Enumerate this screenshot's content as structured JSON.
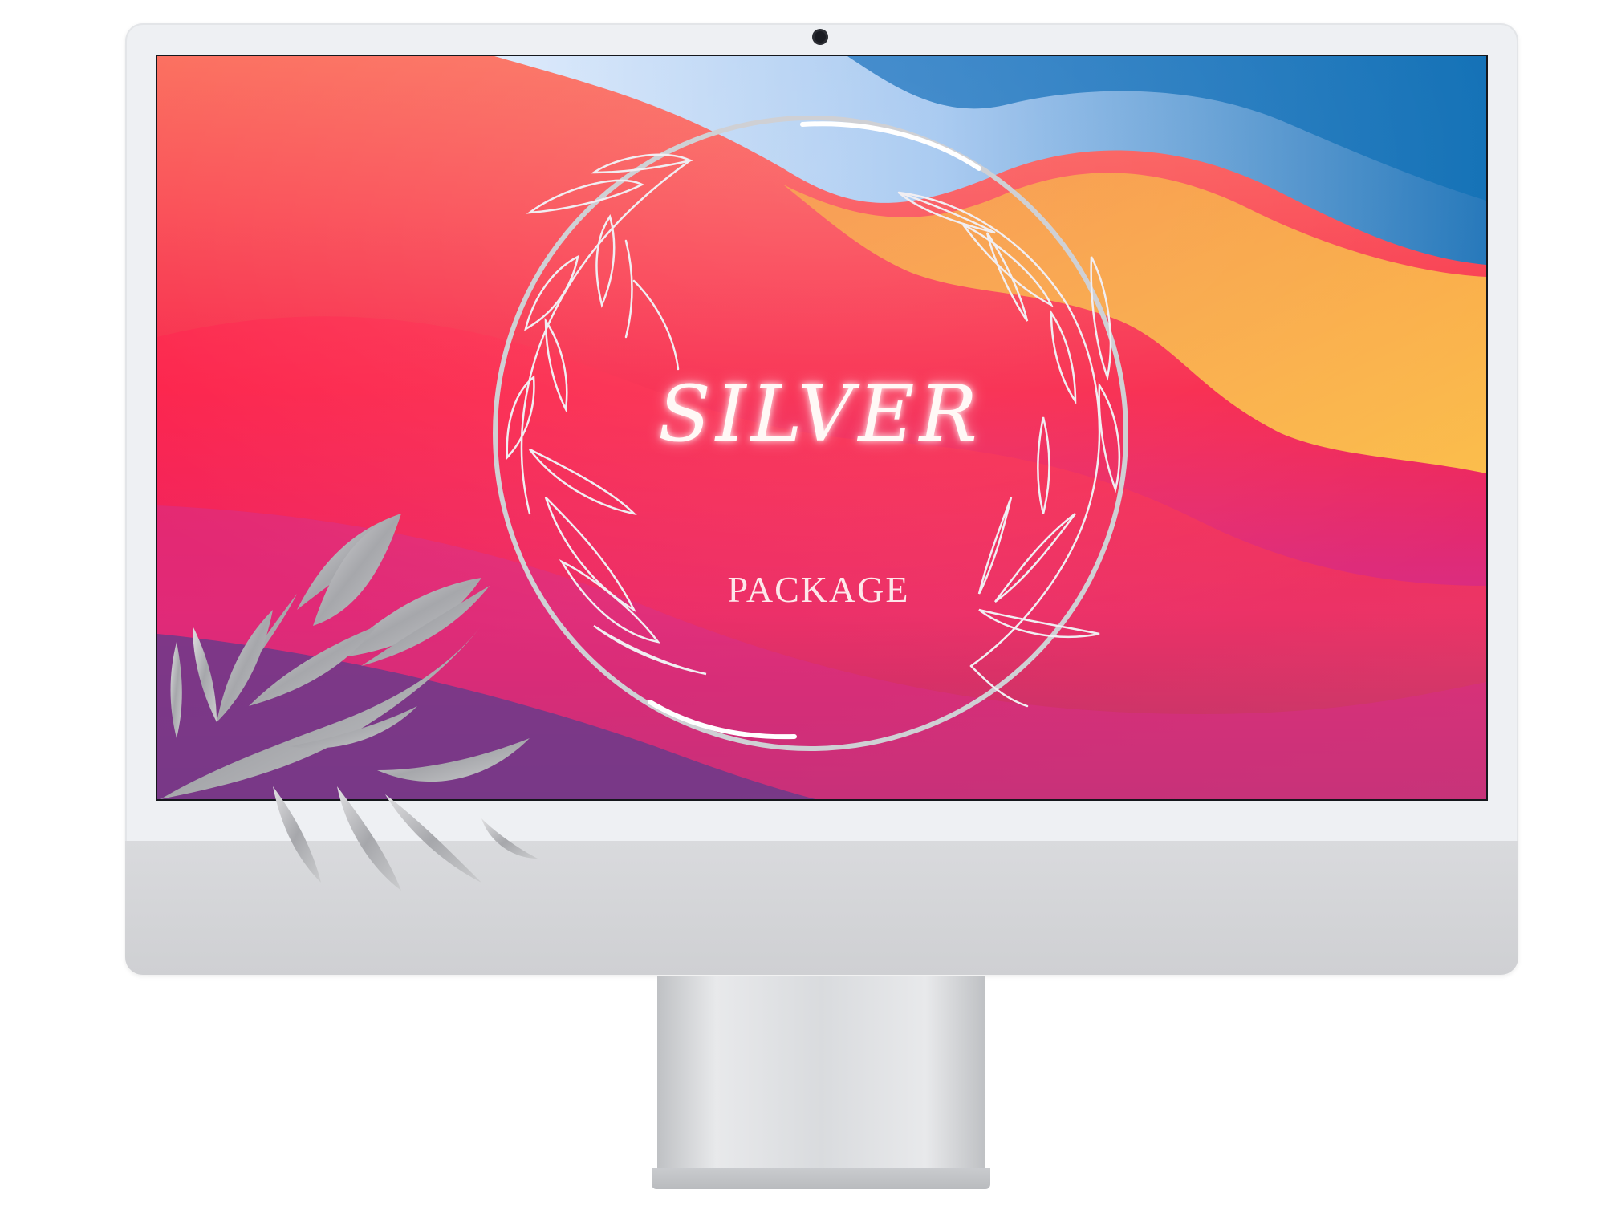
{
  "graphic": {
    "title": "SILVER",
    "subtitle": "PACKAGE"
  },
  "device": {
    "type": "desktop monitor mockup",
    "color": "silver"
  },
  "colors": {
    "frame": "#eef0f3",
    "chin": "#d4d5d8",
    "wallpaper_red": "#f8254a",
    "wallpaper_orange": "#f7a43c",
    "wallpaper_blue": "#1f74b8",
    "wallpaper_magenta": "#d72d86",
    "wallpaper_purple": "#5d3c8c",
    "silver_accent": "#c9cacd"
  },
  "icons": {
    "wreath": "leaf-wreath-icon",
    "leaf": "silver-leaf-branch-icon",
    "camera": "camera-icon"
  }
}
